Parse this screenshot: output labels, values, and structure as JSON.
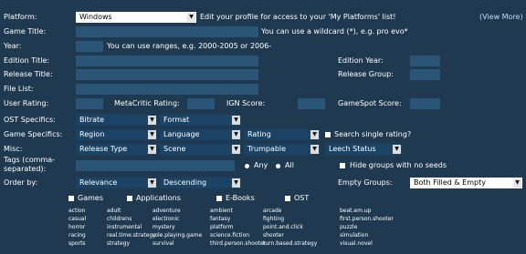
{
  "rows": {
    "platform": {
      "label": "Platform:",
      "value": "Windows",
      "note": "Edit your profile for access to your 'My Platforms' list!",
      "view_more": "(View More)"
    },
    "game_title": {
      "label": "Game Title:",
      "note": "You can use a wildcard (*), e.g. pro evo*"
    },
    "year": {
      "label": "Year:",
      "note": "You can use ranges, e.g. 2000-2005 or 2006-"
    },
    "edition_title": {
      "label": "Edition Title:"
    },
    "edition_year": {
      "label": "Edition Year:"
    },
    "release_title": {
      "label": "Release Title:"
    },
    "release_group": {
      "label": "Release Group:"
    },
    "file_list": {
      "label": "File List:"
    },
    "user_rating": {
      "label": "User Rating:"
    },
    "metacritic": {
      "label": "MetaCritic Rating:"
    },
    "ign": {
      "label": "IGN Score:"
    },
    "gamespot": {
      "label": "GameSpot Score:"
    },
    "ost": {
      "label": "OST Specifics:",
      "bitrate": "Bitrate",
      "format": "Format"
    },
    "game_specifics": {
      "label": "Game Specifics:",
      "region": "Region",
      "language": "Language",
      "rating": "Rating",
      "single_rating": "Search single rating?"
    },
    "misc": {
      "label": "Misc:",
      "release_type": "Release Type",
      "scene": "Scene",
      "trumpable": "Trumpable",
      "leech": "Leech Status"
    },
    "tags": {
      "label_1": "Tags (comma-",
      "label_2": "separated):",
      "any": "Any",
      "all": "All",
      "hide_no_seeds": "Hide groups with no seeds"
    },
    "order": {
      "label": "Order by:",
      "field": "Relevance",
      "direction": "Descending"
    },
    "empty_groups": {
      "label": "Empty Groups:",
      "value": "Both Filled & Empty"
    }
  },
  "categories": [
    "Games",
    "Applications",
    "E-Books",
    "OST"
  ],
  "tag_columns": [
    [
      "action",
      "casual",
      "horror",
      "racing",
      "sports"
    ],
    [
      "adult",
      "childrens",
      "instrumental",
      "real.time.strategy",
      "strategy"
    ],
    [
      "adventure",
      "electronic",
      "mystery",
      "role.playing.game",
      "survival"
    ],
    [
      "ambient",
      "fantasy",
      "platform",
      "science.fiction",
      "third.person.shooter"
    ],
    [
      "arcade",
      "fighting",
      "point.and.click",
      "shooter",
      "turn.based.strategy"
    ],
    [
      "beat.em.up",
      "first.person.shooter",
      "puzzle",
      "simulation",
      "visual.novel"
    ]
  ]
}
